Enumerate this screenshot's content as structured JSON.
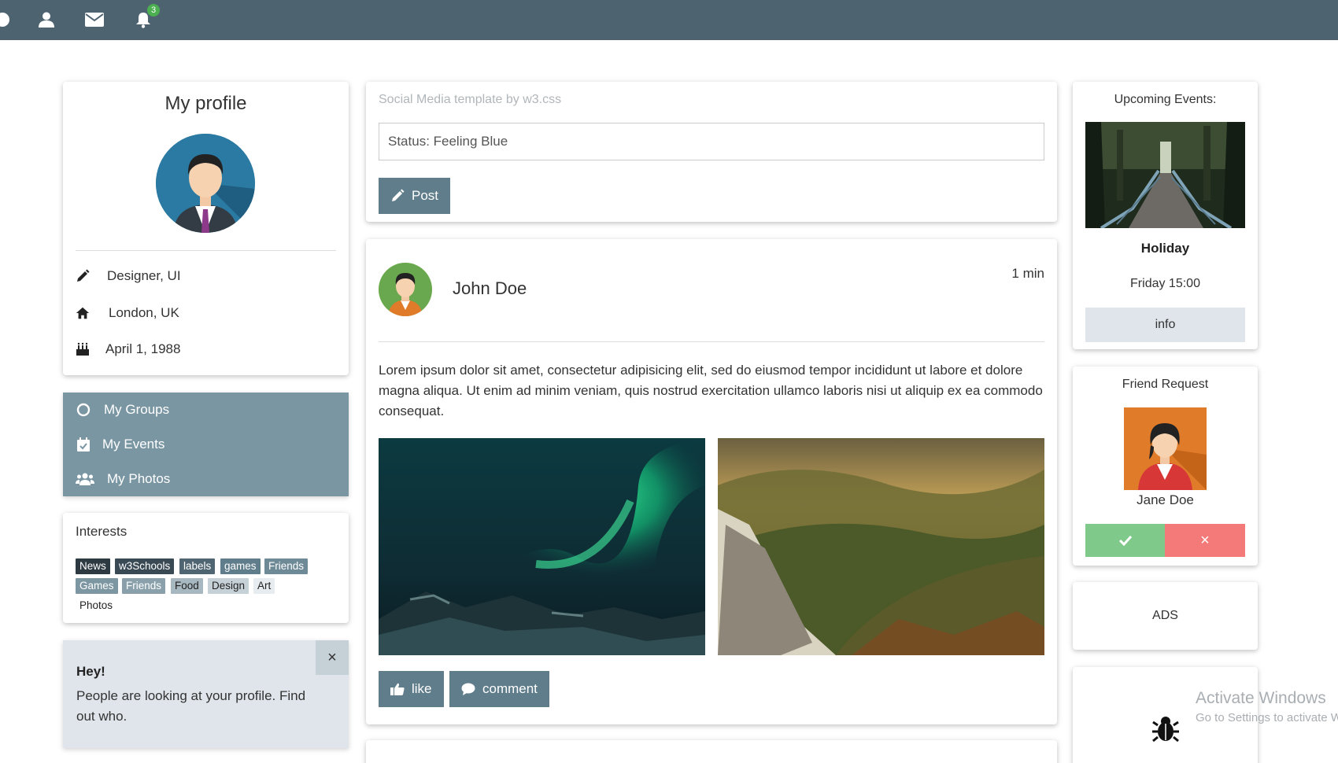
{
  "topbar": {
    "notification_count": "3",
    "icons": [
      "user-icon",
      "envelope-icon",
      "bell-icon"
    ]
  },
  "profile": {
    "title": "My profile",
    "role": "Designer, UI",
    "location": "London, UK",
    "birthday": "April 1, 1988"
  },
  "menu": {
    "groups": "My Groups",
    "events": "My Events",
    "photos": "My Photos"
  },
  "interests": {
    "title": "Interests",
    "tags": [
      "News",
      "w3Schools",
      "labels",
      "games",
      "Friends",
      "Games",
      "Friends",
      "Food",
      "Design",
      "Art",
      "Photos"
    ]
  },
  "alert": {
    "title": "Hey!",
    "message": "People are looking at your profile. Find out who.",
    "close": "×"
  },
  "composer": {
    "label": "Social Media template by w3.css",
    "status_value": "Status: Feeling Blue",
    "post_button": "Post"
  },
  "post": {
    "author": "John Doe",
    "time": "1 min",
    "body": "Lorem ipsum dolor sit amet, consectetur adipisicing elit, sed do eiusmod tempor incididunt ut labore et dolore magna aliqua. Ut enim ad minim veniam, quis nostrud exercitation ullamco laboris nisi ut aliquip ex ea commodo consequat.",
    "like_button": "like",
    "comment_button": "comment"
  },
  "events": {
    "title": "Upcoming Events:",
    "name": "Holiday",
    "when": "Friday 15:00",
    "info_button": "info"
  },
  "friend_request": {
    "title": "Friend Request",
    "name": "Jane Doe",
    "decline": "×"
  },
  "ads": {
    "label": "ADS"
  },
  "windows": {
    "line1": "Activate Windows",
    "line2": "Go to Settings to activate Windows."
  },
  "colors": {
    "topbar": "#4d636f",
    "theme": "#607d8b",
    "menu_item": "#7a96a3",
    "accept": "#7fc98a",
    "decline": "#f47a7a"
  }
}
